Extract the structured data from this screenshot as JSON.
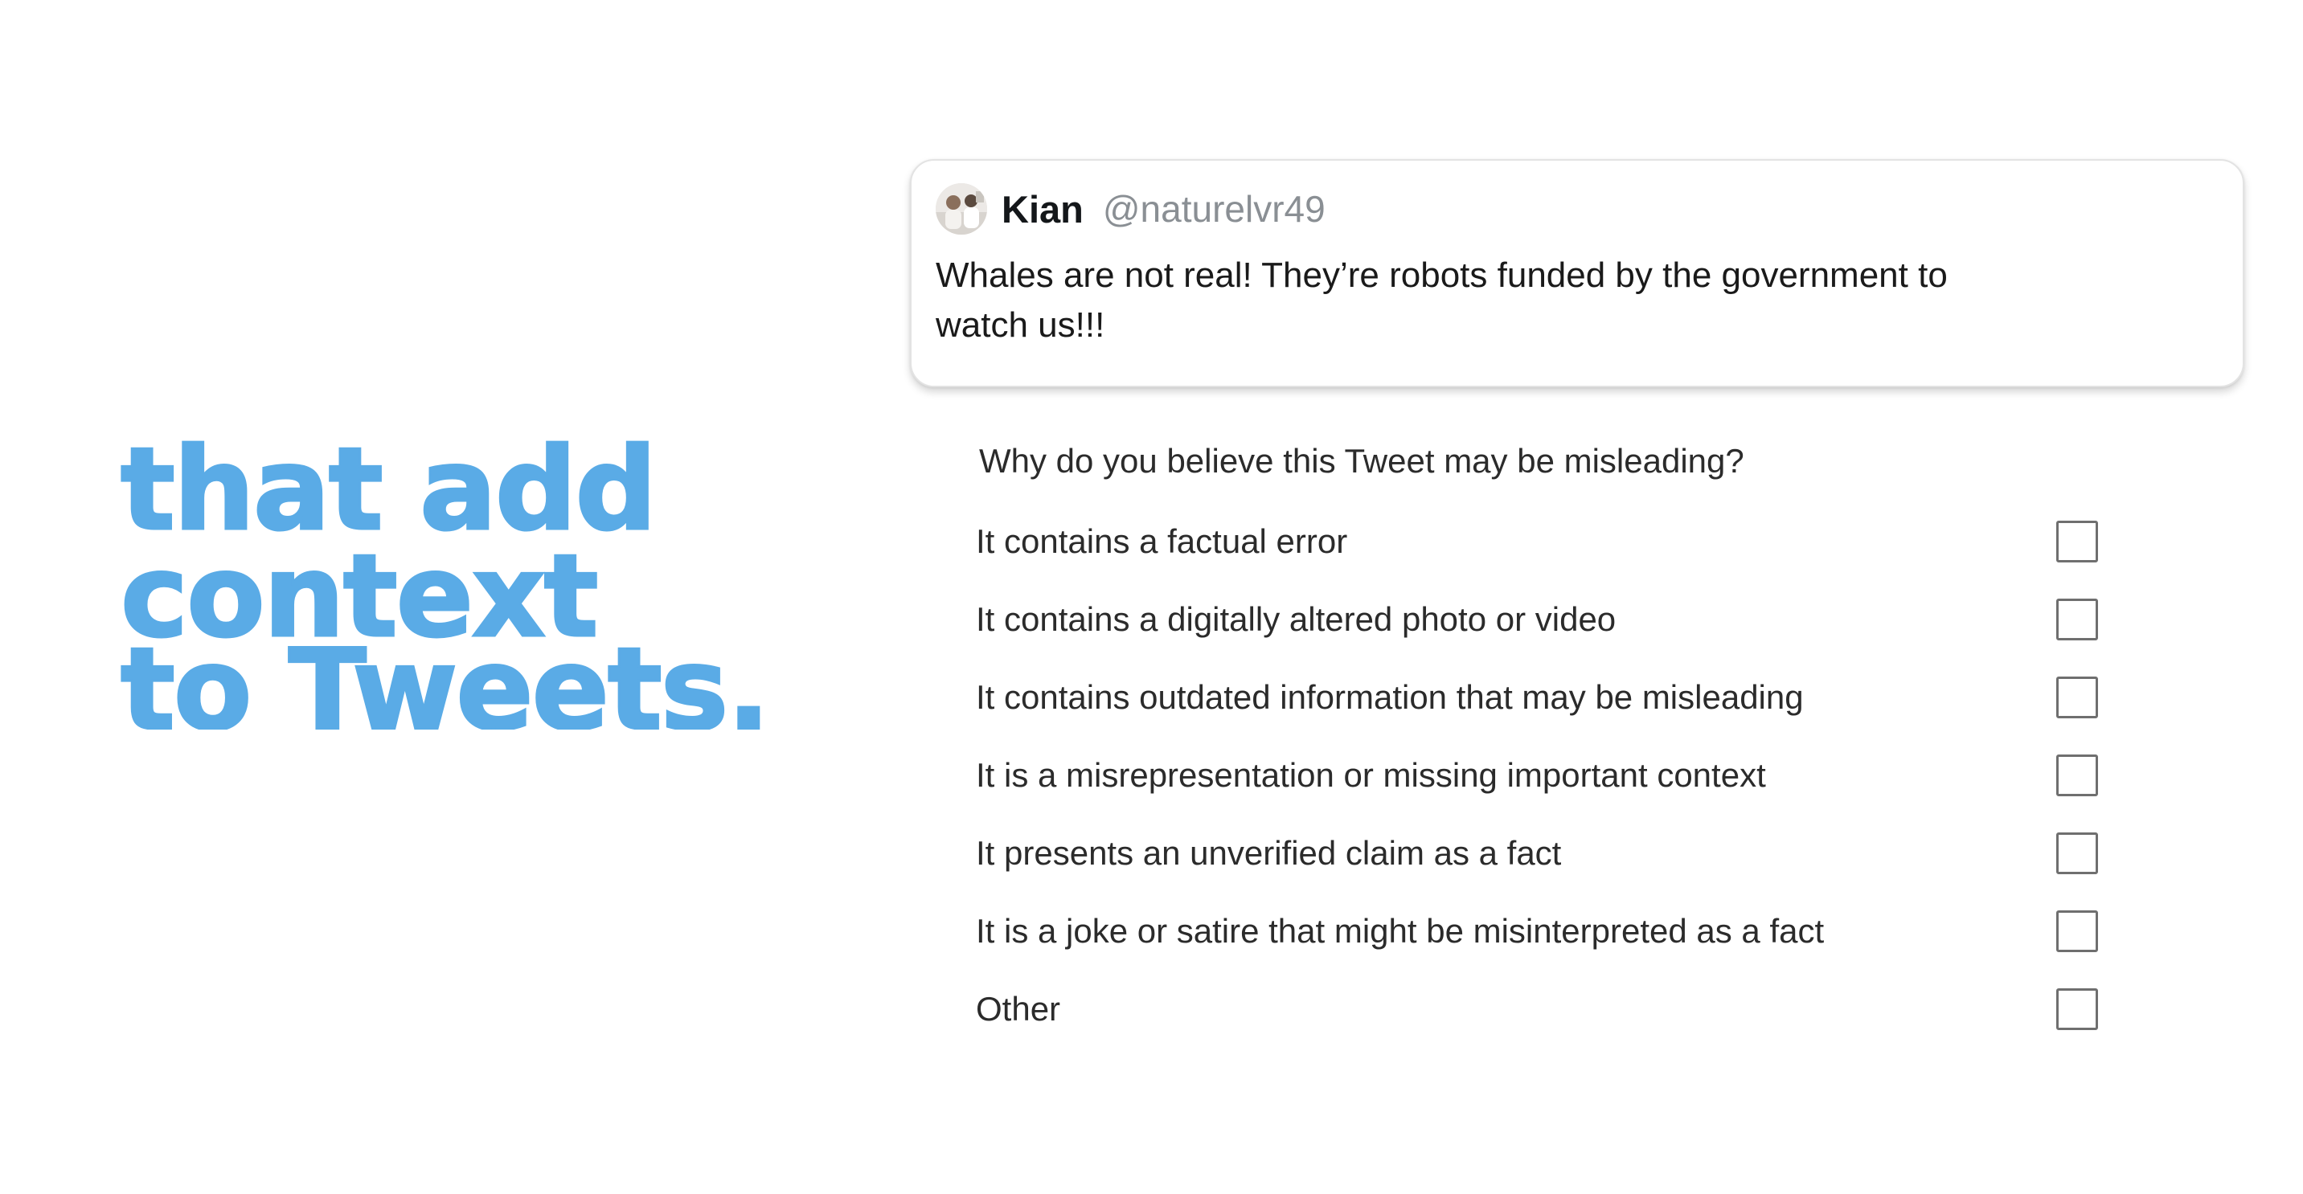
{
  "headline": {
    "line1": "that add",
    "line2": "context",
    "line3": "to Tweets."
  },
  "tweet": {
    "display_name": "Kian",
    "handle": "@naturelvr49",
    "text": "Whales are not real! They’re robots funded by the government to watch us!!!"
  },
  "survey": {
    "question": "Why do you believe this Tweet may be misleading?",
    "options": [
      {
        "label": "It contains a factual error",
        "checked": false
      },
      {
        "label": "It contains a digitally altered photo or video",
        "checked": false
      },
      {
        "label": "It contains outdated information that may be misleading",
        "checked": false
      },
      {
        "label": "It is a misrepresentation or missing important context",
        "checked": false
      },
      {
        "label": "It presents an unverified claim as a fact",
        "checked": false
      },
      {
        "label": "It is a joke or satire that might be misinterpreted as a fact",
        "checked": false
      },
      {
        "label": "Other",
        "checked": false
      }
    ]
  },
  "colors": {
    "headline_blue": "#5aabe6",
    "handle_gray": "#8a8f94",
    "checkbox_border": "#6f6f6f"
  },
  "icons": {
    "avatar": "profile-photo"
  }
}
